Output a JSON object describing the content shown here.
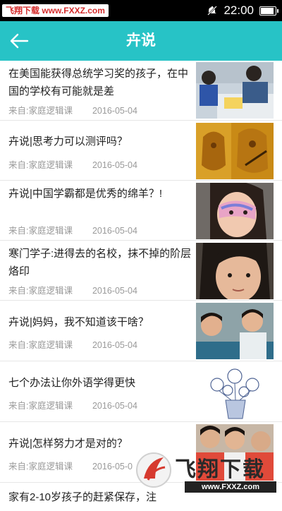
{
  "status_bar": {
    "watermark_a": "飞翔下载",
    "watermark_b": "www.FXXZ.com",
    "time": "22:00"
  },
  "header": {
    "title": "卉说"
  },
  "articles": [
    {
      "title": "在美国能获得总统学习奖的孩子，在中国的学校有可能就是差",
      "source": "来自:家庭逻辑课",
      "date": "2016-05-04"
    },
    {
      "title": "卉说|思考力可以测评吗？",
      "source": "来自:家庭逻辑课",
      "date": "2016-05-04"
    },
    {
      "title": "卉说|中国学霸都是优秀的绵羊？!",
      "source": "来自:家庭逻辑课",
      "date": "2016-05-04"
    },
    {
      "title": "寒门学子:进得去的名校，抹不掉的阶层烙印",
      "source": "来自:家庭逻辑课",
      "date": "2016-05-04"
    },
    {
      "title": "卉说|妈妈，我不知道该干啥？",
      "source": "来自:家庭逻辑课",
      "date": "2016-05-04"
    },
    {
      "title": "七个办法让你外语学得更快",
      "source": "来自:家庭逻辑课",
      "date": "2016-05-04"
    },
    {
      "title": "卉说|怎样努力才是对的？",
      "source": "来自:家庭逻辑课",
      "date": "2016-05-0"
    },
    {
      "title": "家有2-10岁孩子的赶紧保存，注",
      "source": "",
      "date": ""
    }
  ],
  "bottom_watermark": {
    "logo": "飞翔下载",
    "url": "www.FXXZ.com"
  },
  "colors": {
    "header": "#27c3c6",
    "status": "#000000"
  }
}
